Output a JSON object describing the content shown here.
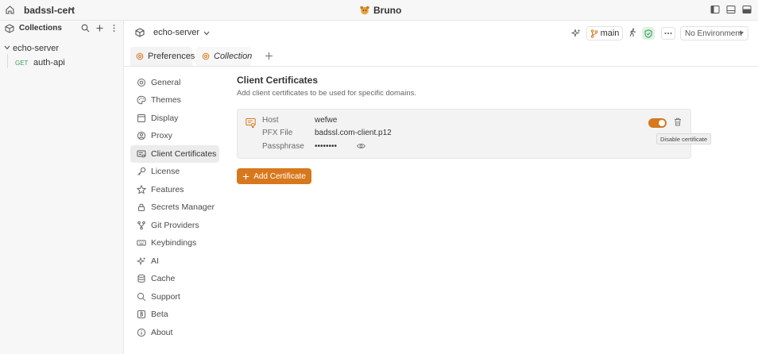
{
  "titlebar": {
    "workspace": "badssl-cert",
    "app_name": "Bruno",
    "icons": [
      "home-icon",
      "chevron-down-icon",
      "bruno-logo-icon",
      "toggle-sidebar-icon",
      "toggle-response-pane-icon",
      "toggle-layout-icon"
    ]
  },
  "sidebar": {
    "header_title": "Collections",
    "collection_name": "echo-server",
    "requests": [
      {
        "method": "GET",
        "name": "auth-api"
      }
    ]
  },
  "header": {
    "collection_title": "echo-server",
    "branch": "main",
    "environment": "No Environment"
  },
  "tabs": {
    "preferences": "Preferences",
    "collection": "Collection"
  },
  "pref_nav": {
    "items": [
      {
        "label": "General",
        "icon": "gear-icon"
      },
      {
        "label": "Themes",
        "icon": "palette-icon"
      },
      {
        "label": "Display",
        "icon": "display-icon"
      },
      {
        "label": "Proxy",
        "icon": "proxy-icon"
      },
      {
        "label": "Client Certificates",
        "icon": "certificate-icon"
      },
      {
        "label": "License",
        "icon": "key-icon"
      },
      {
        "label": "Features",
        "icon": "star-icon"
      },
      {
        "label": "Secrets Manager",
        "icon": "lock-icon"
      },
      {
        "label": "Git Providers",
        "icon": "git-icon"
      },
      {
        "label": "Keybindings",
        "icon": "keyboard-icon"
      },
      {
        "label": "AI",
        "icon": "sparkle-icon"
      },
      {
        "label": "Cache",
        "icon": "database-icon"
      },
      {
        "label": "Support",
        "icon": "search-icon"
      },
      {
        "label": "Beta",
        "icon": "beta-icon"
      },
      {
        "label": "About",
        "icon": "info-icon"
      }
    ],
    "active": "Client Certificates"
  },
  "content": {
    "title": "Client Certificates",
    "description": "Add client certificates to be used for specific domains.",
    "certificate": {
      "host_label": "Host",
      "host_value": "wefwe",
      "pfx_label": "PFX File",
      "pfx_value": "badssl.com-client.p12",
      "passphrase_label": "Passphrase",
      "passphrase_value": "••••••••",
      "enabled": true
    },
    "tooltip": "Disable certificate",
    "add_button": "Add Certificate"
  },
  "colors": {
    "accent": "#d7781c",
    "active_nav_bg": "#ececec",
    "card_bg": "#f3f3f3",
    "method_get": "#3f9e58"
  }
}
